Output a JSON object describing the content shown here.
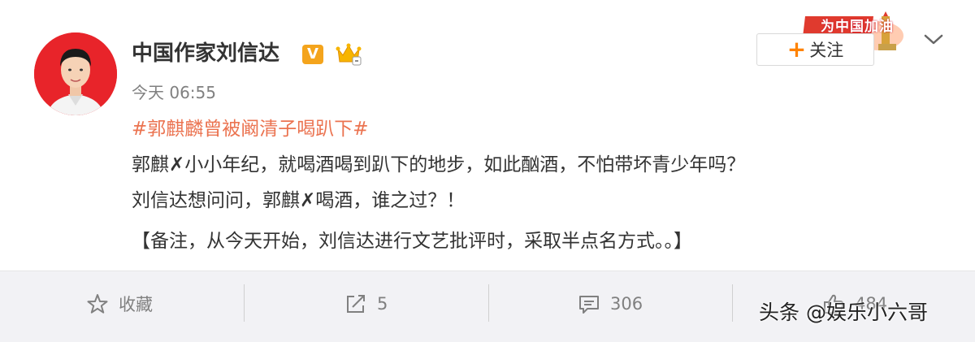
{
  "post": {
    "username": "中国作家刘信达",
    "verified_badge": "V",
    "timestamp": "今天 06:55",
    "hashtag": "#郭麒麟曾被阚清子喝趴下#",
    "lines": [
      "郭麒✗小小年纪，就喝酒喝到趴下的地步，如此酗酒，不怕带坏青少年吗？",
      "刘信达想问问，郭麒✗喝酒，谁之过？！",
      "【备注，从今天开始，刘信达进行文艺批评时，采取半点名方式。。】"
    ]
  },
  "header": {
    "promo_text": "为中国加油",
    "follow_plus": "+",
    "follow_label": "关注"
  },
  "actions": {
    "favorite_label": "收藏",
    "forward_count": "5",
    "comment_count": "306",
    "like_count": "484"
  },
  "watermark": "头条 @娱乐小六哥",
  "colors": {
    "hashtag": "#eb7350",
    "follow_plus": "#ff8200",
    "verified": "#f4a41c",
    "avatar_bg": "#e8242a",
    "action_bar_bg": "#f2f2f5"
  },
  "icons": [
    "verified-v-icon",
    "crown-icon",
    "chevron-down-icon",
    "star-icon",
    "forward-icon",
    "comment-icon",
    "thumbs-up-icon"
  ]
}
